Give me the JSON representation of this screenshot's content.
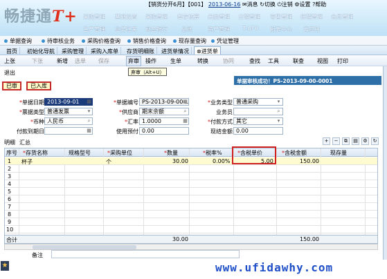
{
  "header": {
    "logo_text": "畅捷通",
    "logo_suffix": "T+",
    "account": "【销货分开6月】",
    "account_code": "【001】",
    "date": "2013-06-16",
    "messages": "消息",
    "switch": "切换",
    "logout": "注销",
    "settings": "设置",
    "help": "帮助",
    "menu_row1": [
      "采购管理",
      "基础设置",
      "采购管理",
      "库存核算",
      "出纳管理",
      "分销管理",
      "零售管理",
      "促销管理",
      "会员管理"
    ],
    "menu_row2": [
      "生产管理",
      "业务往来",
      "现金银行",
      "总账",
      "资产管理",
      "T-UFO",
      "报表中心",
      "云应用"
    ]
  },
  "bookmarks": [
    "单据查询",
    "待审核业务",
    "采购价格查询",
    "销售价格查询",
    "现存量查询",
    "凭证管理"
  ],
  "tabs": [
    "首页",
    "初始化导航",
    "采购管理",
    "采购入库单",
    "存货明细账",
    "进货单情况",
    "进货单"
  ],
  "toolbar": {
    "items": [
      "上张",
      "下张",
      "新增",
      "选单",
      "保存",
      "弃审",
      "操作",
      "生单",
      "转换",
      "协同",
      "查找",
      "工具",
      "联查",
      "视图",
      "打印"
    ],
    "tooltip": "弃审（Alt+U）",
    "exit": "退出"
  },
  "status": {
    "message": "单据审核成功！PS-2013-09-00-0001",
    "badge1": "已审",
    "badge2": "已入库"
  },
  "form": {
    "doc_date_label": "单据日期",
    "doc_date": "2013-09-01",
    "doc_no_label": "单据编号",
    "doc_no": "PS-2013-09-00-...",
    "biz_type_label": "业务类型",
    "biz_type": "普通采购",
    "invoice_type_label": "票据类型",
    "invoice_type": "普通发票",
    "supplier_label": "供应商",
    "supplier": "期末余额",
    "salesman_label": "业务员",
    "salesman": "",
    "currency_label": "币种",
    "currency": "人民币",
    "rate_label": "汇率",
    "rate": "1.0000",
    "pay_method_label": "付款方式",
    "pay_method": "其它",
    "pay_due_label": "付款到期日",
    "pay_due": "",
    "prepay_label": "使用预付",
    "prepay": "0.00",
    "cash_label": "现结金额",
    "cash": "0.00"
  },
  "grid": {
    "tabs": [
      "明细",
      "汇总"
    ],
    "headers": [
      "序号",
      "存货名称",
      "规格型号",
      "采购单位",
      "数量",
      "税率%",
      "含税单价",
      "含税金额",
      "现存量"
    ],
    "rows": [
      {
        "no": "1",
        "name": "杯子",
        "spec": "",
        "unit": "个",
        "qty": "30.00",
        "tax": "0.00%",
        "price": "5.00",
        "amount": "150.00",
        "stock": ""
      }
    ],
    "empty_rows": [
      "2",
      "3",
      "4",
      "5",
      "6",
      "7",
      "8",
      "9",
      "10"
    ],
    "totals_label": "合计",
    "total_qty": "30.00",
    "total_amount": "150.00"
  },
  "remark_label": "备注",
  "watermark": "www.ufidawhy.com"
}
